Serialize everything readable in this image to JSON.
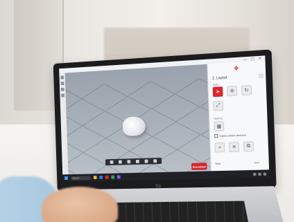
{
  "app": {
    "panel_title": "2. Layout",
    "section_tools": "Tools",
    "section_options": "Options",
    "checkbox_label": "Enable collision detection",
    "footer_left": "Back",
    "footer_right": "Next"
  },
  "taskbar": {
    "search_placeholder": "Search"
  },
  "brand": {
    "badge_text": "Renishaw",
    "laptop_logo": "hp"
  },
  "colors": {
    "accent": "#e4262c",
    "viewport": "#a9b1ba",
    "panel": "#f7f8f9"
  }
}
